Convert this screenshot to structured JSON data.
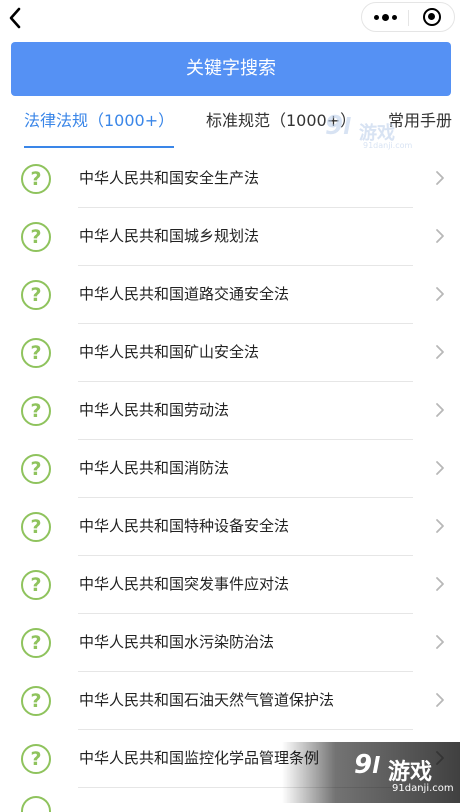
{
  "topbar": {
    "back_icon": "chevron-left-icon",
    "more_icon": "more-dots-icon",
    "close_icon": "target-close-icon"
  },
  "search": {
    "label": "关键字搜索"
  },
  "tabs": [
    {
      "label": "法律法规（1000+）",
      "active": true
    },
    {
      "label": "标准规范（1000+）",
      "active": false
    },
    {
      "label": "常用手册",
      "active": false
    }
  ],
  "colors": {
    "accent": "#3a86e8",
    "button_bg": "#5591f4",
    "icon_green": "#8fc35d"
  },
  "items": [
    {
      "icon": "question-icon",
      "q": "?",
      "title": "中华人民共和国安全生产法"
    },
    {
      "icon": "question-icon",
      "q": "?",
      "title": "中华人民共和国城乡规划法"
    },
    {
      "icon": "question-icon",
      "q": "?",
      "title": "中华人民共和国道路交通安全法"
    },
    {
      "icon": "question-icon",
      "q": "?",
      "title": "中华人民共和国矿山安全法"
    },
    {
      "icon": "question-icon",
      "q": "?",
      "title": "中华人民共和国劳动法"
    },
    {
      "icon": "question-icon",
      "q": "?",
      "title": "中华人民共和国消防法"
    },
    {
      "icon": "question-icon",
      "q": "?",
      "title": "中华人民共和国特种设备安全法"
    },
    {
      "icon": "question-icon",
      "q": "?",
      "title": "中华人民共和国突发事件应对法"
    },
    {
      "icon": "question-icon",
      "q": "?",
      "title": "中华人民共和国水污染防治法"
    },
    {
      "icon": "question-icon",
      "q": "?",
      "title": "中华人民共和国石油天然气管道保护法"
    },
    {
      "icon": "question-icon",
      "q": "?",
      "title": "中华人民共和国监控化学品管理条例"
    }
  ],
  "watermark": {
    "logo_num": "9",
    "logo_cn": "游戏",
    "site": "91danji.com"
  }
}
